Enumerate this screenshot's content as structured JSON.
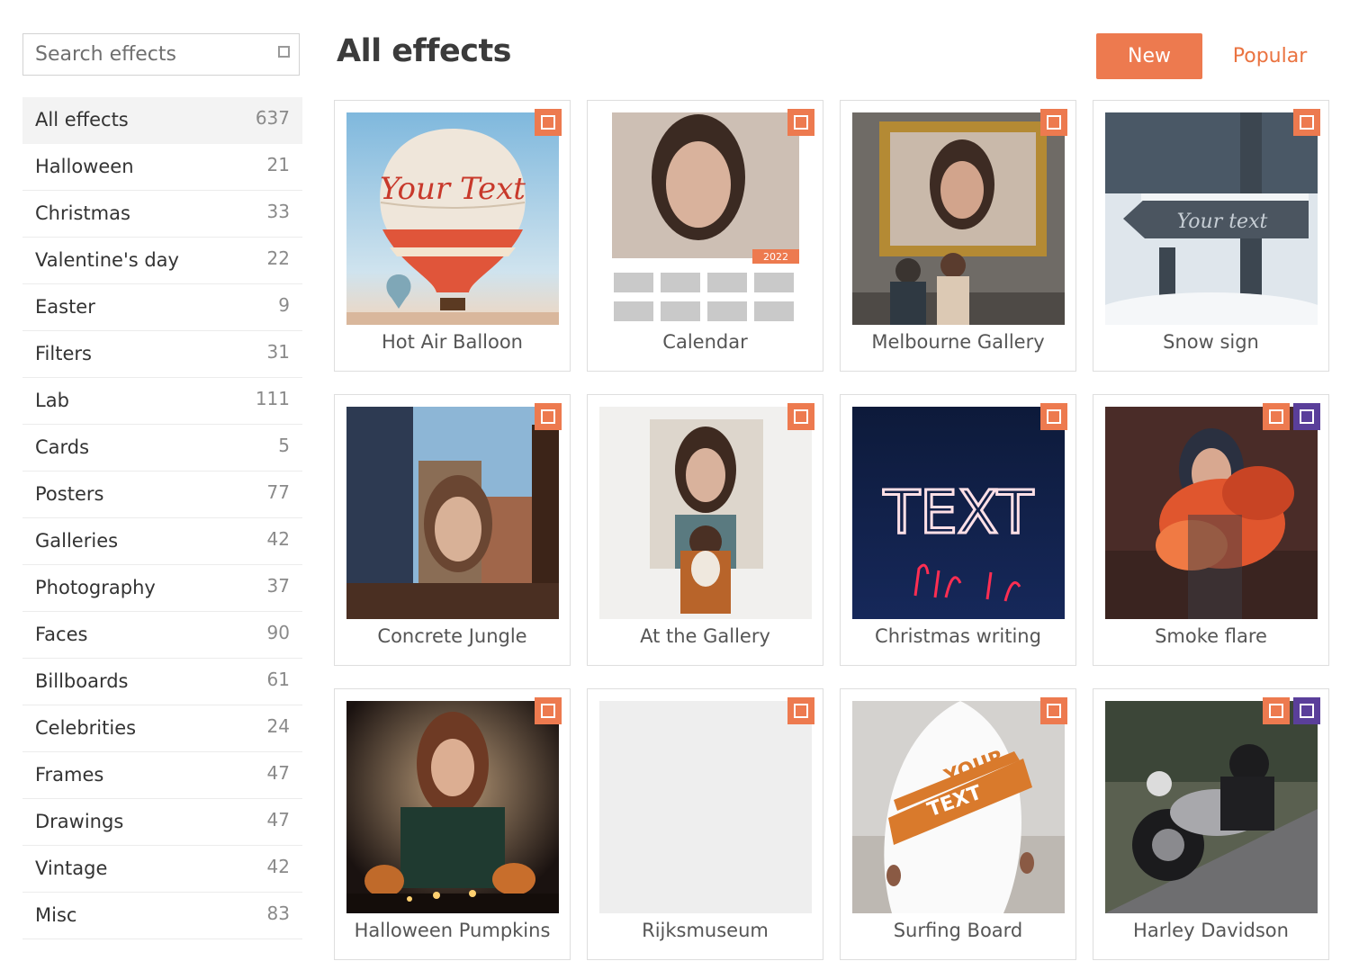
{
  "search": {
    "placeholder": "Search effects",
    "icon": "square-icon"
  },
  "header": {
    "title": "All effects",
    "new_label": "New",
    "popular_label": "Popular"
  },
  "colors": {
    "accent": "#ed7a4f",
    "purple_badge": "#5a3f9a"
  },
  "categories": [
    {
      "label": "All effects",
      "count": "637",
      "active": true
    },
    {
      "label": "Halloween",
      "count": "21"
    },
    {
      "label": "Christmas",
      "count": "33"
    },
    {
      "label": "Valentine's day",
      "count": "22"
    },
    {
      "label": "Easter",
      "count": "9"
    },
    {
      "label": "Filters",
      "count": "31"
    },
    {
      "label": "Lab",
      "count": "111"
    },
    {
      "label": "Cards",
      "count": "5"
    },
    {
      "label": "Posters",
      "count": "77"
    },
    {
      "label": "Galleries",
      "count": "42"
    },
    {
      "label": "Photography",
      "count": "37"
    },
    {
      "label": "Faces",
      "count": "90"
    },
    {
      "label": "Billboards",
      "count": "61"
    },
    {
      "label": "Celebrities",
      "count": "24"
    },
    {
      "label": "Frames",
      "count": "47"
    },
    {
      "label": "Drawings",
      "count": "47"
    },
    {
      "label": "Vintage",
      "count": "42"
    },
    {
      "label": "Misc",
      "count": "83"
    }
  ],
  "effects": [
    {
      "name": "Hot Air Balloon",
      "thumb_text": "Your Text",
      "badges": [
        "orange"
      ]
    },
    {
      "name": "Calendar",
      "thumb_text": "2022",
      "badges": [
        "orange"
      ]
    },
    {
      "name": "Melbourne Gallery",
      "badges": [
        "orange"
      ]
    },
    {
      "name": "Snow sign",
      "thumb_text": "Your text",
      "badges": [
        "orange"
      ]
    },
    {
      "name": "Concrete Jungle",
      "badges": [
        "orange"
      ]
    },
    {
      "name": "At the Gallery",
      "badges": [
        "orange"
      ]
    },
    {
      "name": "Christmas writing",
      "thumb_text": "TEXT",
      "badges": [
        "orange"
      ]
    },
    {
      "name": "Smoke flare",
      "badges": [
        "orange",
        "purple"
      ]
    },
    {
      "name": "Halloween Pumpkins",
      "badges": [
        "orange"
      ]
    },
    {
      "name": "Rijksmuseum",
      "badges": [
        "orange"
      ]
    },
    {
      "name": "Surfing Board",
      "thumb_text": [
        "YOUR",
        "TEXT"
      ],
      "badges": [
        "orange"
      ]
    },
    {
      "name": "Harley Davidson",
      "badges": [
        "orange",
        "purple"
      ]
    }
  ]
}
